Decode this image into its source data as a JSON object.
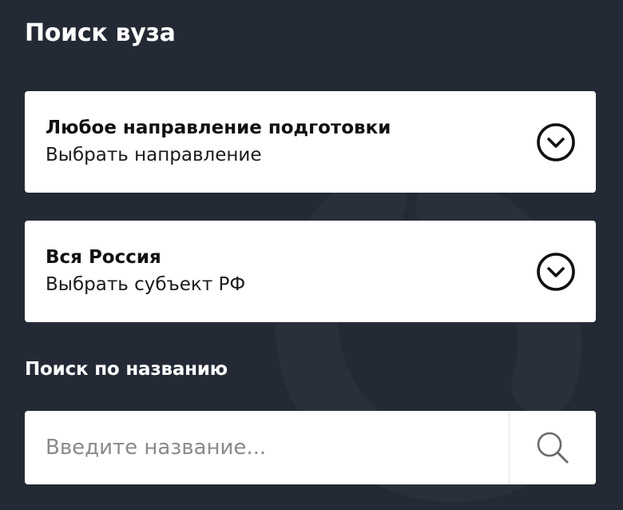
{
  "page": {
    "title": "Поиск вуза"
  },
  "filters": [
    {
      "title": "Любое направление подготовки",
      "subtitle": "Выбрать направление",
      "icon": "chevron-down-circle-icon"
    },
    {
      "title": "Вся Россия",
      "subtitle": "Выбрать субъект РФ",
      "icon": "chevron-down-circle-icon"
    }
  ],
  "search": {
    "label": "Поиск по названию",
    "placeholder": "Введите название...",
    "value": "",
    "icon": "search-icon"
  },
  "colors": {
    "background": "#242a35",
    "card": "#ffffff",
    "text_dark": "#111111",
    "placeholder": "#8a8a8a"
  }
}
